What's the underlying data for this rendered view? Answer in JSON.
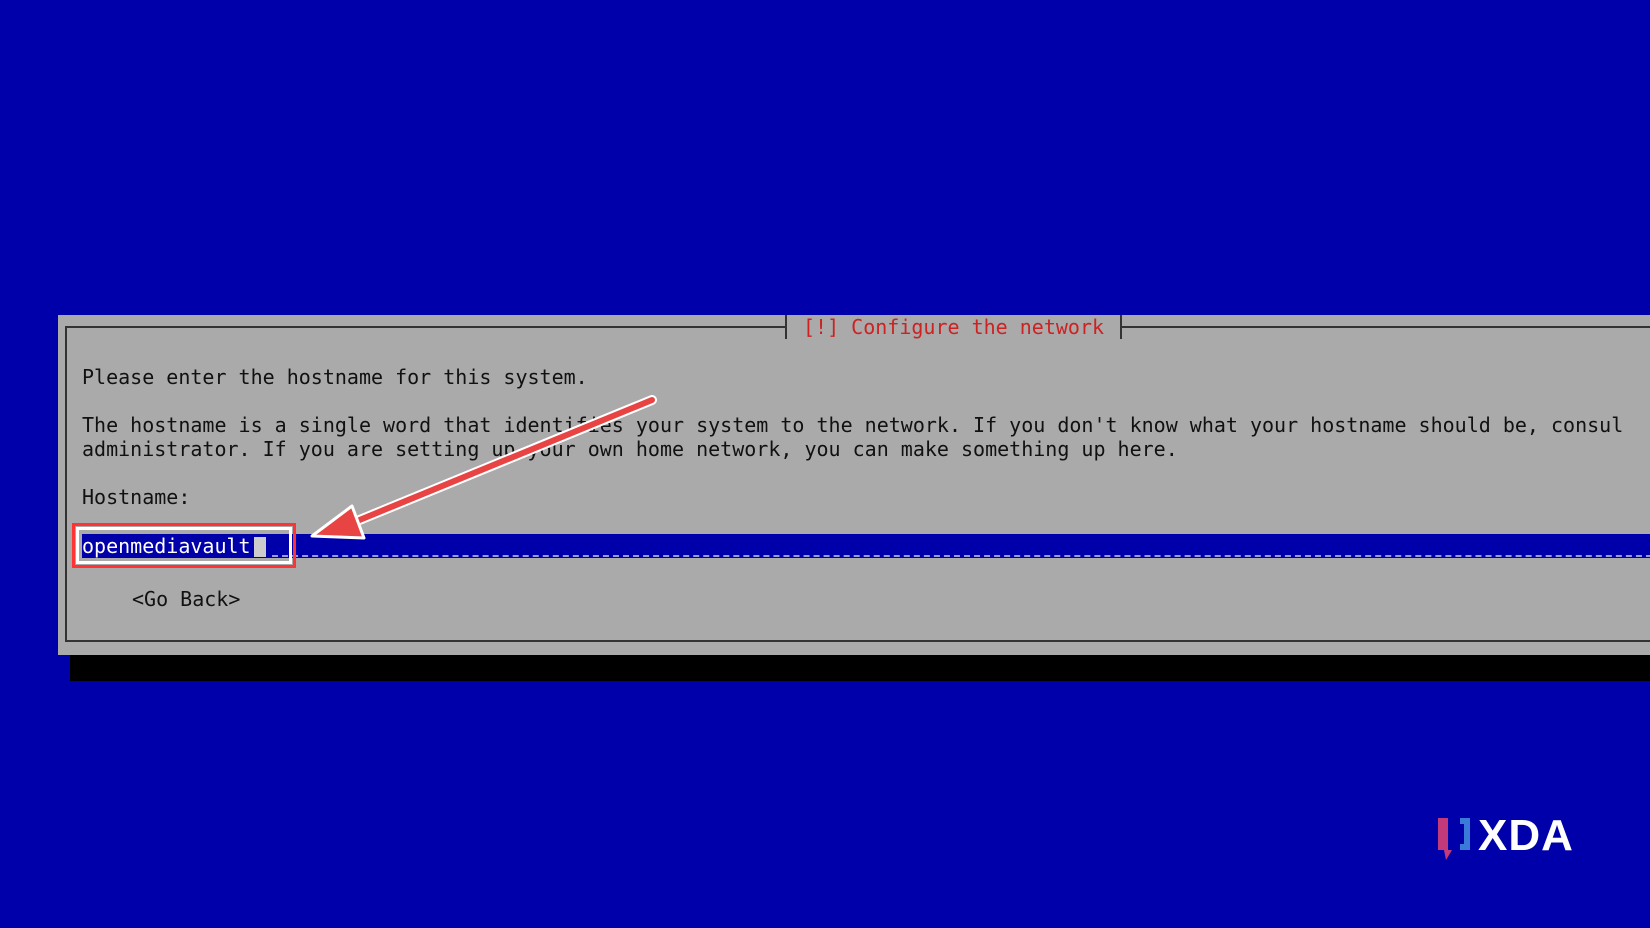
{
  "dialog": {
    "title": "[!] Configure the network",
    "prompt": "Please enter the hostname for this system.",
    "description_line_1": "The hostname is a single word that identifies your system to the network. If you don't know what your hostname should be, consul",
    "description_line_2": "administrator. If you are setting up your own home network, you can make something up here.",
    "hostname_label": "Hostname:",
    "hostname_value": "openmediavault",
    "go_back_label": "<Go Back>"
  },
  "watermark": {
    "brand": "XDA"
  },
  "colors": {
    "background": "#0000aa",
    "dialog": "#aaaaaa",
    "title": "#cc2222",
    "annotation": "#ff3333",
    "shadow": "#000000"
  },
  "icons": {
    "annotation_arrow": "arrow-icon",
    "brand_mark": "xda-logo-icon"
  }
}
